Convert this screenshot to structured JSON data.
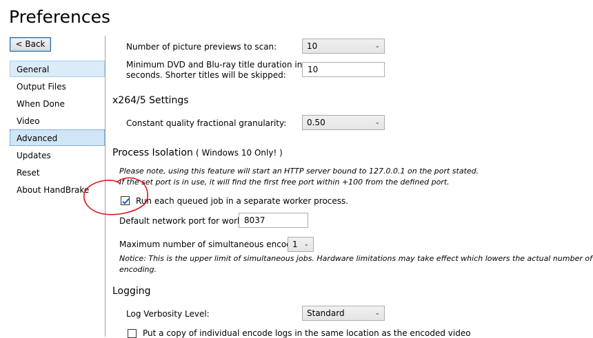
{
  "window": {
    "title": "Preferences"
  },
  "nav": {
    "back_label": "< Back",
    "items": [
      {
        "label": "General"
      },
      {
        "label": "Output Files"
      },
      {
        "label": "When Done"
      },
      {
        "label": "Video"
      },
      {
        "label": "Advanced"
      },
      {
        "label": "Updates"
      },
      {
        "label": "Reset"
      },
      {
        "label": "About HandBrake"
      }
    ]
  },
  "scan": {
    "previews_label": "Number of picture previews to scan:",
    "previews_value": "10",
    "min_duration_label_line1": "Minimum DVD and Blu-ray title duration in",
    "min_duration_label_line2": "seconds. Shorter titles will be skipped:",
    "min_duration_value": "10"
  },
  "x264": {
    "heading": "x264/5 Settings",
    "cq_label": "Constant quality fractional granularity:",
    "cq_value": "0.50"
  },
  "process_isolation": {
    "heading": "Process Isolation",
    "heading_note": "( Windows 10 Only! )",
    "note_line1": "Please note, using this feature will start an HTTP server bound to 127.0.0.1 on the port stated.",
    "note_line2": "If the set port is in use, it will find the first free port within +100 from the defined port.",
    "checkbox_label": "Run each queued job in a separate worker process.",
    "checkbox_checked": true,
    "port_label": "Default network port for worker:",
    "port_value": "8037",
    "max_label": "Maximum number of simultaneous encodes:",
    "max_value": "1",
    "notice_line1": "Notice: This is the upper limit of simultaneous jobs. Hardware limitations may take effect which lowers the actual number of simulta",
    "notice_line2": "encoding."
  },
  "logging": {
    "heading": "Logging",
    "verbosity_label": "Log Verbosity Level:",
    "verbosity_value": "Standard",
    "copy_logs_label": "Put a copy of individual encode logs in the same location as the encoded video"
  },
  "colors": {
    "annotation": "#d8141c",
    "check_accent": "#1a5fb4",
    "selection_bg": "#dbecf8"
  }
}
